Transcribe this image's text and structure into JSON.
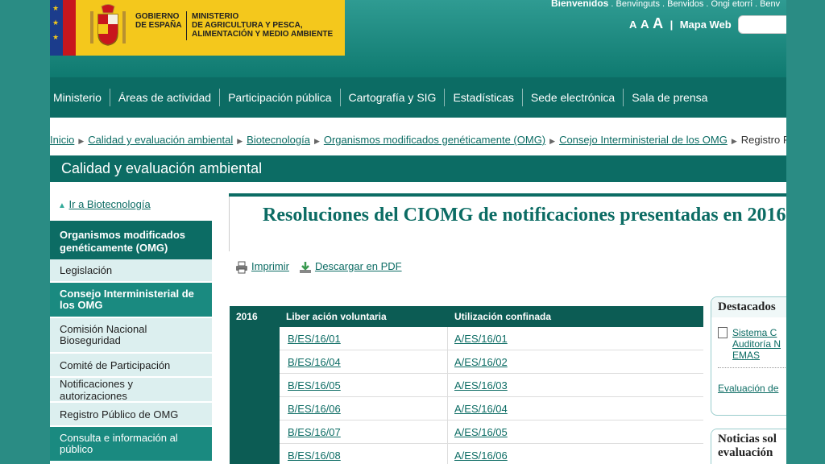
{
  "header": {
    "gov_label": [
      "GOBIERNO",
      "DE ESPAÑA"
    ],
    "ministry_label": [
      "MINISTERIO",
      "DE AGRICULTURA Y PESCA,",
      "ALIMENTACIÓN Y MEDIO AMBIENTE"
    ],
    "welcome_bold": "Bienvenidos",
    "welcome_rest": " . Benvinguts . Benvidos . Ongi etorri . Benv",
    "font_a1": "A",
    "font_a2": "A",
    "font_a3": "A",
    "separator": "|",
    "mapa_web": "Mapa Web"
  },
  "nav": [
    "Ministerio",
    "Áreas de actividad",
    "Participación pública",
    "Cartografía y SIG",
    "Estadísticas",
    "Sede electrónica",
    "Sala de prensa"
  ],
  "breadcrumb": {
    "links": [
      "Inicio",
      "Calidad y evaluación ambiental",
      "Biotecnología",
      "Organismos modificados genéticamente (OMG)",
      "Consejo Interministerial de los OMG"
    ],
    "current": "Registro Púb"
  },
  "section_title": "Calidad y evaluación ambiental",
  "sidebar": {
    "back_link": "Ir a Biotecnología",
    "heading": "Organismos modificados genéticamente (OMG)",
    "items": [
      {
        "label": "Legislación",
        "active": false
      },
      {
        "label": "Consejo Interministerial de los OMG",
        "active": true
      },
      {
        "label": "Comisión Nacional Bioseguridad",
        "active": false
      },
      {
        "label": "Comité de Participación",
        "active": false
      },
      {
        "label": "Notificaciones y autorizaciones",
        "active": false
      },
      {
        "label": "Registro Público de OMG",
        "active": false
      },
      {
        "label": "Consulta e información al público",
        "active": true
      }
    ]
  },
  "content": {
    "title": "Resoluciones del CIOMG de notificaciones presentadas en 2016",
    "print_label": "Imprimir",
    "pdf_label": "Descargar en PDF"
  },
  "table": {
    "headers": [
      "2016",
      "Liber ación voluntaria",
      "Utilización confinada"
    ],
    "rows": [
      [
        "B/ES/16/01",
        "A/ES/16/01"
      ],
      [
        "B/ES/16/04",
        "A/ES/16/02"
      ],
      [
        "B/ES/16/05",
        "A/ES/16/03"
      ],
      [
        "B/ES/16/06",
        "A/ES/16/04"
      ],
      [
        "B/ES/16/07",
        "A/ES/16/05"
      ],
      [
        "B/ES/16/08",
        "A/ES/16/06"
      ]
    ]
  },
  "destacados": {
    "title": "Destacados",
    "item1": [
      "Sistema C",
      "Auditoría N",
      "EMAS"
    ],
    "item2": "Evaluación de"
  },
  "noticias": {
    "title": [
      "Noticias sol",
      "evaluación"
    ]
  },
  "colors": {
    "primary": "#0c6c64",
    "header_teal": "#2f9b92",
    "gov_yellow": "#f4c81c",
    "sidebar_light": "#dcefef"
  }
}
